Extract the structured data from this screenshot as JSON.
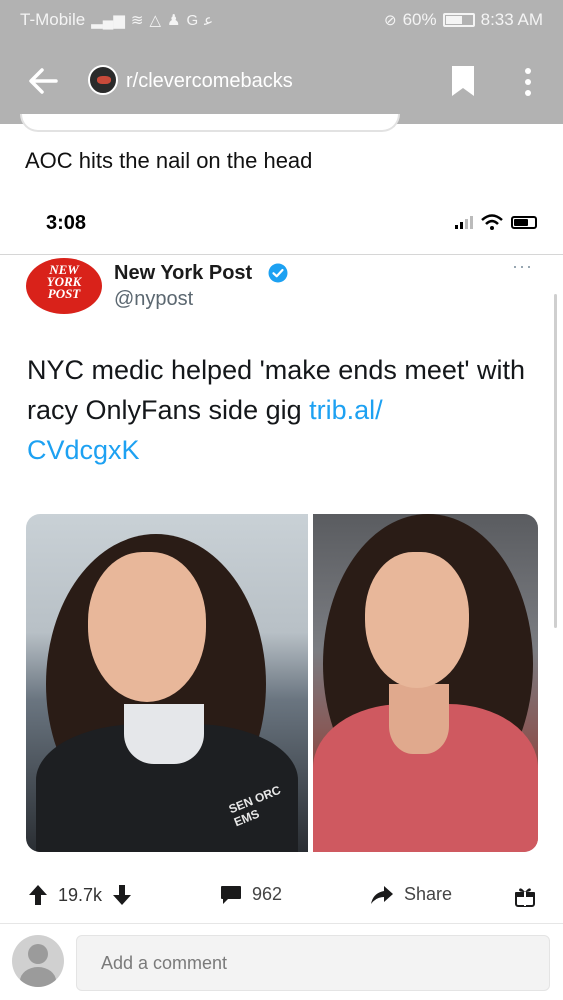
{
  "status_bar": {
    "carrier": "T-Mobile",
    "left_icons": [
      "signal-icon",
      "wifi-icon",
      "alert-icon",
      "person-icon",
      "g-icon",
      "arabic-icon"
    ],
    "battery": "60%",
    "battery_level": 0.6,
    "time": "8:33 AM"
  },
  "app_bar": {
    "subreddit": "r/clevercomebacks",
    "icons": [
      "back-arrow-icon",
      "subreddit-avatar-icon",
      "bookmark-icon",
      "more-vert-icon"
    ]
  },
  "post": {
    "title": "AOC hits the nail on the head"
  },
  "screenshot": {
    "time": "3:08",
    "logo_lines": [
      "NEW",
      "YORK",
      "POST"
    ],
    "account_name": "New York Post",
    "handle": "@nypost",
    "more": "···",
    "tweet_text": "NYC medic helped 'make ends meet' with racy OnlyFans side gig ",
    "tweet_link": "trib.al/\nCVdcgxK",
    "patch_text": "SEN ORC\nEMS"
  },
  "actions": {
    "upvotes": "19.7k",
    "comments": "962",
    "share": "Share"
  },
  "comment_box": {
    "placeholder": "Add a comment"
  },
  "colors": {
    "app_bar": "#b2b2b2",
    "link": "#1da1f2",
    "nyp_red": "#d9221a",
    "verified_blue": "#1da1f2"
  }
}
